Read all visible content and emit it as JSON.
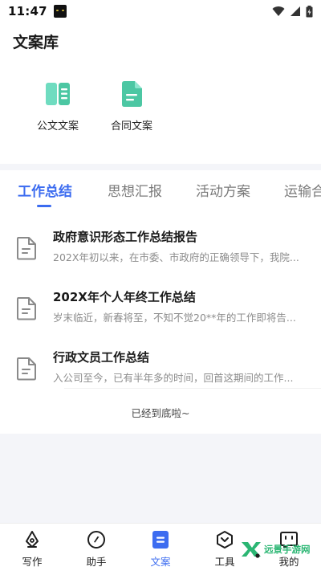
{
  "status_bar": {
    "time": "11:47"
  },
  "header": {
    "title": "文案库"
  },
  "categories": [
    {
      "label": "公文文案",
      "icon": "book-icon",
      "color": "#5dd3b6"
    },
    {
      "label": "合同文案",
      "icon": "document-icon",
      "color": "#4cc7a3"
    }
  ],
  "tabs": [
    {
      "label": "工作总结",
      "active": true
    },
    {
      "label": "思想汇报",
      "active": false
    },
    {
      "label": "活动方案",
      "active": false
    },
    {
      "label": "运输合",
      "active": false
    }
  ],
  "documents": [
    {
      "title": "政府意识形态工作总结报告",
      "description": "202X年初以来，在市委、市政府的正确领导下，我院..."
    },
    {
      "title": "202X年个人年终工作总结",
      "description": "岁末临近，新春将至，不知不觉20**年的工作即将告..."
    },
    {
      "title": "行政文员工作总结",
      "description": "入公司至今，已有半年多的时间，回首这期间的工作..."
    }
  ],
  "list_end_text": "已经到底啦~",
  "bottom_nav": [
    {
      "label": "写作",
      "icon": "pen-nib-icon",
      "active": false
    },
    {
      "label": "助手",
      "icon": "compass-icon",
      "active": false
    },
    {
      "label": "文案",
      "icon": "document-icon",
      "active": true
    },
    {
      "label": "工具",
      "icon": "hexagon-icon",
      "active": false
    },
    {
      "label": "我的",
      "icon": "chat-face-icon",
      "active": false
    }
  ],
  "watermark": {
    "text": "远景手游网"
  },
  "colors": {
    "accent": "#3c6cf0",
    "teal": "#4cc7a3",
    "watermark_green": "#2bb673"
  }
}
